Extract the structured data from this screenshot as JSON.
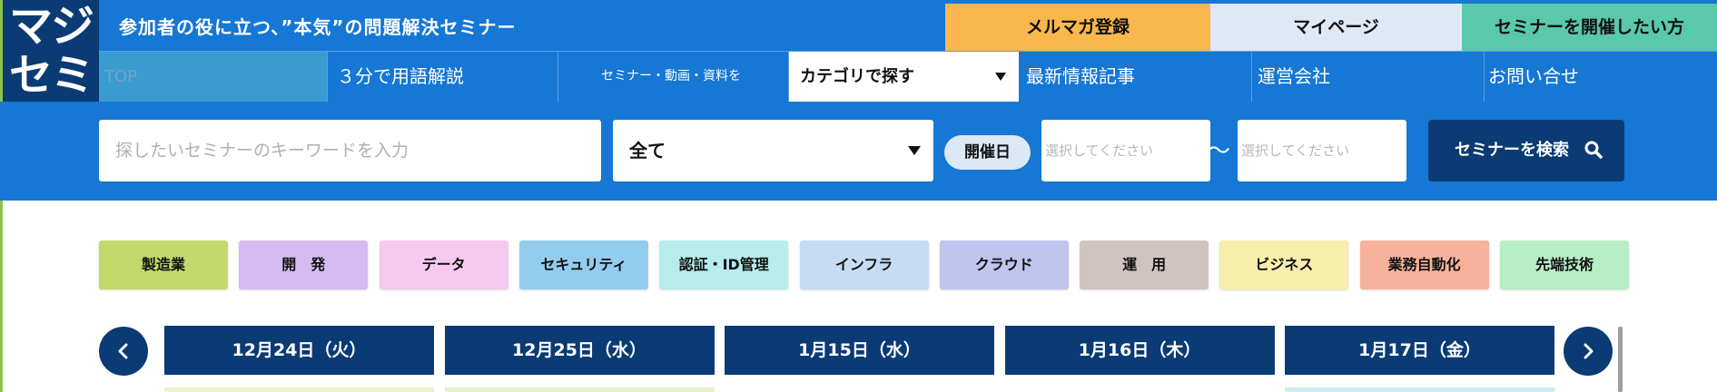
{
  "logo": {
    "line1": "マジ",
    "line2": "セミ"
  },
  "header": {
    "tagline": "参加者の役に立つ、”本気”の問題解決セミナー",
    "mail_label": "メルマガ登録",
    "mypage_label": "マイページ",
    "host_label": "セミナーを開催したい方"
  },
  "nav": {
    "top": "TOP",
    "yogo": "３分で用語解説",
    "small": "セミナー・動画・資料を",
    "category": "カテゴリで探す",
    "news": "最新情報記事",
    "company": "運営会社",
    "contact": "お問い合せ"
  },
  "search": {
    "keyword_placeholder": "探したいセミナーのキーワードを入力",
    "category_selected": "全て",
    "date_label": "開催日",
    "from_placeholder": "選択してください",
    "tilde": "〜",
    "to_placeholder": "選択してください",
    "button_label": "セミナーを検索"
  },
  "tags": [
    {
      "label": "製造業",
      "color": "#c3d96b"
    },
    {
      "label": "開　発",
      "color": "#d3bdf0"
    },
    {
      "label": "データ",
      "color": "#f6c9ef"
    },
    {
      "label": "セキュリティ",
      "color": "#94ccee"
    },
    {
      "label": "認証・ID管理",
      "color": "#b6ecec"
    },
    {
      "label": "インフラ",
      "color": "#c5dcf3"
    },
    {
      "label": "クラウド",
      "color": "#c0c5ee"
    },
    {
      "label": "運　用",
      "color": "#cfc4c0"
    },
    {
      "label": "ビジネス",
      "color": "#f7eeab"
    },
    {
      "label": "業務自動化",
      "color": "#f7b29c"
    },
    {
      "label": "先端技術",
      "color": "#b7eec5"
    }
  ],
  "dates": [
    {
      "label": "12月24日（火）",
      "under": "#eaf3c8"
    },
    {
      "label": "12月25日（水）",
      "under": "#e6f1c8"
    },
    {
      "label": "1月15日（水）",
      "under": "#ffffff"
    },
    {
      "label": "1月16日（木）",
      "under": "#ffffff"
    },
    {
      "label": "1月17日（金）",
      "under": "#cdeef0"
    }
  ],
  "colors": {
    "brand_blue": "#1677d4",
    "navy": "#0b3b74"
  }
}
